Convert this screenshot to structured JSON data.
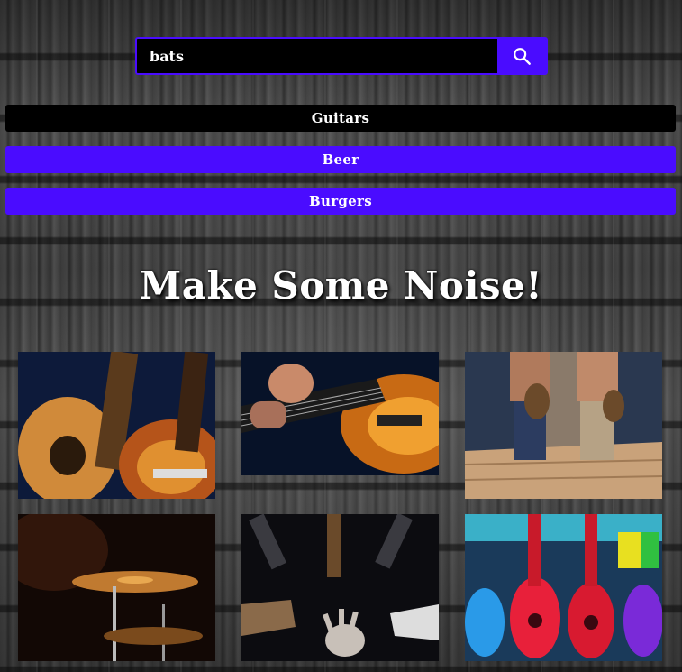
{
  "search": {
    "value": "bats"
  },
  "categories": [
    {
      "label": "Guitars",
      "active": false
    },
    {
      "label": "Beer",
      "active": true
    },
    {
      "label": "Burgers",
      "active": true
    }
  ],
  "headline": "Make Some Noise!",
  "colors": {
    "accent": "#4a0cff",
    "dark": "#000000",
    "text": "#ffffff"
  },
  "gallery": [
    {
      "subject": "acoustic and electric guitars"
    },
    {
      "subject": "hand on guitar neck"
    },
    {
      "subject": "two people walking with guitars"
    },
    {
      "subject": "drum cymbals"
    },
    {
      "subject": "guitars with hand"
    },
    {
      "subject": "colorful ukuleles"
    }
  ]
}
